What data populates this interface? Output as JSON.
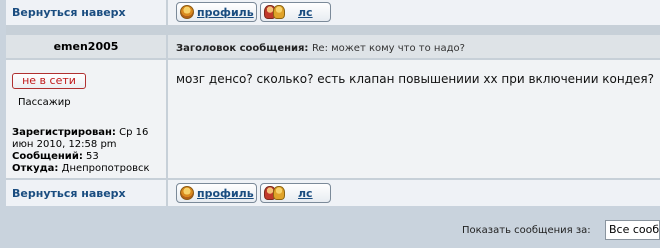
{
  "top_row": {
    "back_to_top": "Вернуться наверх",
    "profile_label": "профиль",
    "pm_label": "лс"
  },
  "post": {
    "author": "emen2005",
    "subject_label": "Заголовок сообщения:",
    "subject_value": "Re: может кому что то надо?",
    "status_badge": "не в сети",
    "rank": "Пассажир",
    "registered_label": "Зарегистрирован:",
    "registered_value": "Ср 16 июн 2010, 12:58 pm",
    "posts_label": "Сообщений:",
    "posts_value": "53",
    "from_label": "Откуда:",
    "from_value": "Днепропотровск",
    "message": "мозг денсо? сколько? есть клапан повышениии хх при включении кондея?"
  },
  "bottom_row": {
    "back_to_top": "Вернуться наверх",
    "profile_label": "профиль",
    "pm_label": "лс"
  },
  "footer": {
    "show_messages_label": "Показать сообщения за:",
    "period_value": "Все сообщения"
  },
  "colors": {
    "link": "#1a4d80",
    "offline": "#c01818",
    "row_light": "#eff2f6",
    "row_dark": "#dee3e7"
  },
  "icons": {
    "profile": "profile-person-icon",
    "pm": "pm-two-persons-icon"
  }
}
